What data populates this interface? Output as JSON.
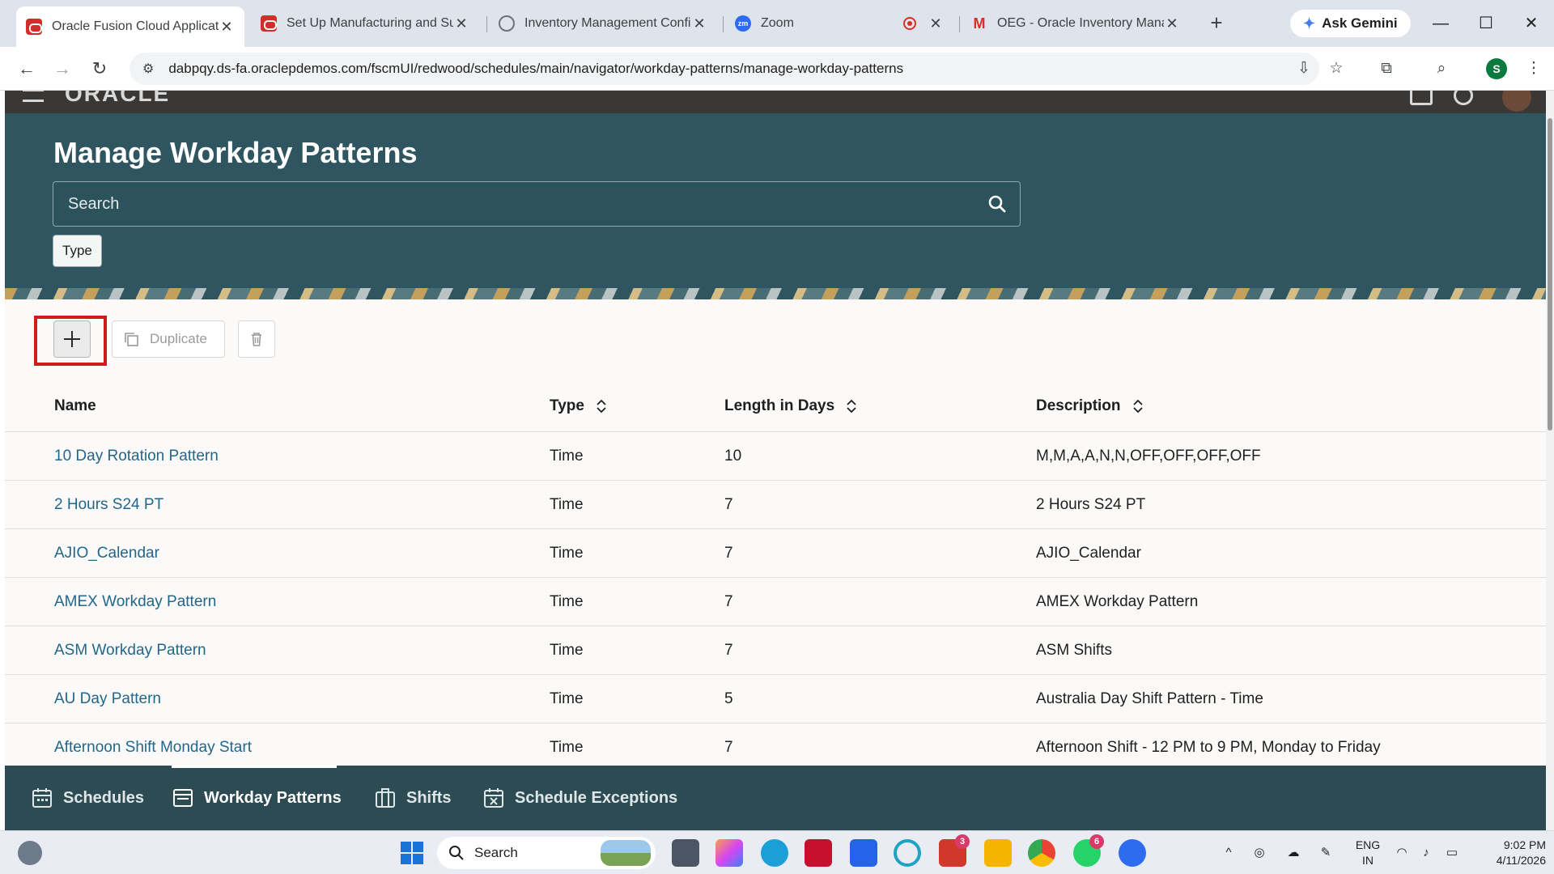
{
  "browser": {
    "tabs": [
      {
        "title": "Oracle Fusion Cloud Applicatio",
        "active": true
      },
      {
        "title": "Set Up Manufacturing and Sup",
        "active": false
      },
      {
        "title": "Inventory Management Config",
        "active": false
      },
      {
        "title": "Zoom",
        "active": false
      },
      {
        "title": "OEG - Oracle Inventory Manag",
        "active": false
      }
    ],
    "ask_gemini": "Ask Gemini",
    "url": "dabpqy.ds-fa.oraclepdemos.com/fscmUI/redwood/schedules/main/navigator/workday-patterns/manage-workday-patterns",
    "profile_initial": "S"
  },
  "page": {
    "title": "Manage Workday Patterns",
    "search_placeholder": "Search",
    "filter_chip": "Type",
    "actions": {
      "duplicate_label": "Duplicate"
    },
    "table": {
      "columns": [
        "Name",
        "Type",
        "Length in Days",
        "Description"
      ],
      "rows": [
        {
          "name": "10 Day Rotation Pattern",
          "type": "Time",
          "length": "10",
          "description": "M,M,A,A,N,N,OFF,OFF,OFF,OFF"
        },
        {
          "name": "2 Hours S24 PT",
          "type": "Time",
          "length": "7",
          "description": "2 Hours S24 PT"
        },
        {
          "name": "AJIO_Calendar",
          "type": "Time",
          "length": "7",
          "description": "AJIO_Calendar"
        },
        {
          "name": "AMEX Workday Pattern",
          "type": "Time",
          "length": "7",
          "description": "AMEX Workday Pattern"
        },
        {
          "name": "ASM Workday Pattern",
          "type": "Time",
          "length": "7",
          "description": "ASM Shifts"
        },
        {
          "name": "AU Day Pattern",
          "type": "Time",
          "length": "5",
          "description": "Australia Day Shift Pattern - Time"
        },
        {
          "name": "Afternoon Shift Monday Start",
          "type": "Time",
          "length": "7",
          "description": "Afternoon Shift - 12 PM to 9 PM, Monday to Friday"
        }
      ]
    },
    "bottom_nav": [
      {
        "label": "Schedules",
        "icon": "calendar-icon",
        "active": false
      },
      {
        "label": "Workday Patterns",
        "icon": "pattern-icon",
        "active": true
      },
      {
        "label": "Shifts",
        "icon": "shifts-icon",
        "active": false
      },
      {
        "label": "Schedule Exceptions",
        "icon": "calendar-exception-icon",
        "active": false
      }
    ]
  },
  "taskbar": {
    "search_label": "Search",
    "lens_badge": "3",
    "whatsapp_badge": "6",
    "lang_line1": "ENG",
    "lang_line2": "IN",
    "time": "9:02 PM",
    "date": "4/11/2026"
  },
  "colors": {
    "banner": "#2f5660",
    "bottom_nav": "#2c4b52",
    "link": "#22668a",
    "highlight": "#d11a1a"
  }
}
